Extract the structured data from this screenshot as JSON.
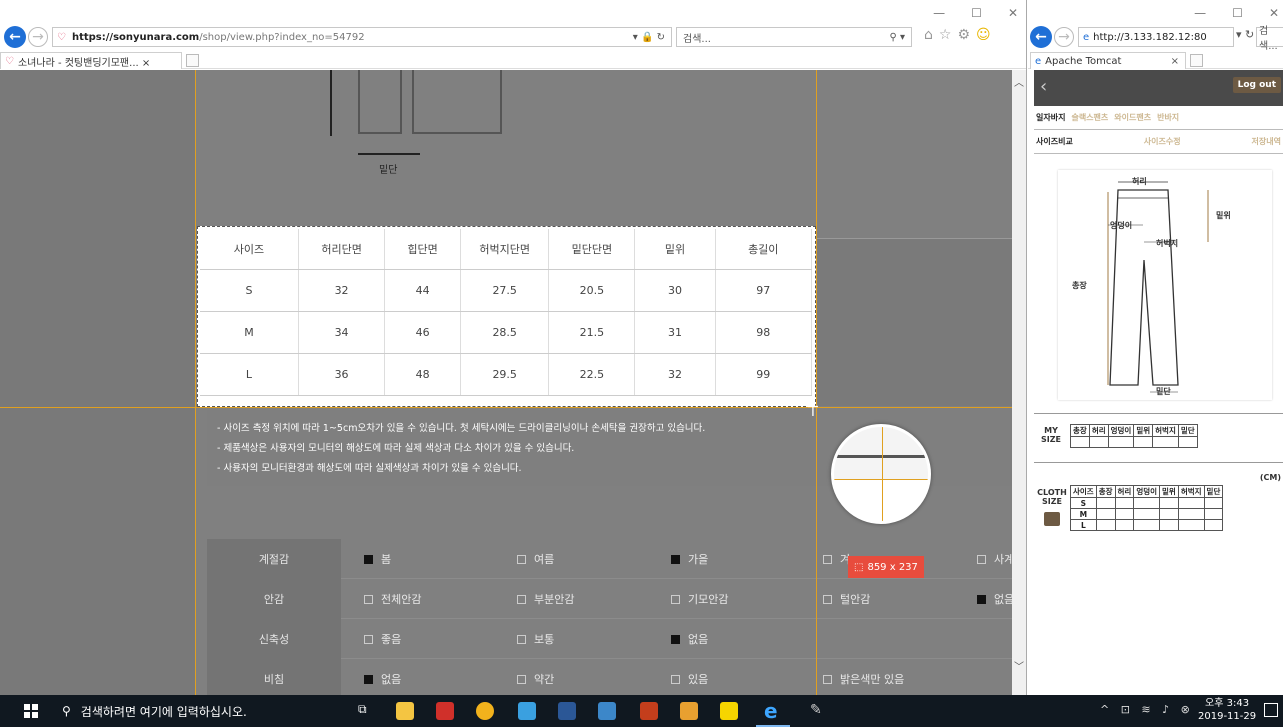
{
  "left_browser": {
    "url_prefix": "https://sonyunara.com",
    "url_path": "/shop/view.php?index_no=54792",
    "search_placeholder": "검색...",
    "tab_title": "소녀나라 - 컷팅밴딩기모팬... ×"
  },
  "page": {
    "diagram_label": "밑단",
    "measure_table": {
      "headers": [
        "사이즈",
        "허리단면",
        "힙단면",
        "허벅지단면",
        "밑단단면",
        "밑위",
        "총길이"
      ],
      "rows": [
        [
          "S",
          "32",
          "44",
          "27.5",
          "20.5",
          "30",
          "97"
        ],
        [
          "M",
          "34",
          "46",
          "28.5",
          "21.5",
          "31",
          "98"
        ],
        [
          "L",
          "36",
          "48",
          "29.5",
          "22.5",
          "32",
          "99"
        ]
      ]
    },
    "notes": [
      "- 사이즈 측정 위치에 따라 1~5cm오차가 있을 수 있습니다. 첫 세탁시에는 드라이클리닝이나 손세탁을 권장하고 있습니다.",
      "- 제품색상은 사용자의 모니터의 해상도에 따라 실제 색상과 다소 차이가 있을 수 있습니다.",
      "- 사용자의 모니터환경과 해상도에 따라 실제색상과 차이가 있을 수 있습니다."
    ],
    "attributes": [
      {
        "label": "계절감",
        "options": [
          {
            "text": "봄",
            "checked": true
          },
          {
            "text": "여름",
            "checked": false
          },
          {
            "text": "가을",
            "checked": true
          },
          {
            "text": "겨",
            "checked": false
          },
          {
            "text": "사계",
            "checked": false
          }
        ]
      },
      {
        "label": "안감",
        "options": [
          {
            "text": "전체안감",
            "checked": false
          },
          {
            "text": "부분안감",
            "checked": false
          },
          {
            "text": "기모안감",
            "checked": false
          },
          {
            "text": "털안감",
            "checked": false
          },
          {
            "text": "없음",
            "checked": true
          }
        ]
      },
      {
        "label": "신축성",
        "options": [
          {
            "text": "좋음",
            "checked": false
          },
          {
            "text": "보통",
            "checked": false
          },
          {
            "text": "없음",
            "checked": true
          }
        ]
      },
      {
        "label": "비침",
        "options": [
          {
            "text": "없음",
            "checked": true
          },
          {
            "text": "약간",
            "checked": false
          },
          {
            "text": "있음",
            "checked": false
          },
          {
            "text": "밝은색만 있음",
            "checked": false
          }
        ]
      }
    ],
    "capture_size": "859 x 237"
  },
  "right_browser": {
    "url": "http://3.133.182.12:80",
    "search_placeholder": "검색...",
    "tab_title": "Apache Tomcat",
    "logout_label": "Log out",
    "category_tabs": [
      "일자바지",
      "슬랙스팬츠",
      "와이드팬츠",
      "반바지"
    ],
    "sub_tabs": [
      "사이즈비교",
      "사이즈수정",
      "저장내역"
    ],
    "pants_labels": {
      "waist": "허리",
      "rise": "밑위",
      "hip": "엉덩이",
      "thigh": "허벅지",
      "length": "총장",
      "hem": "밑단"
    },
    "my_size_label": "MY SIZE",
    "my_size_headers": [
      "총장",
      "허리",
      "엉덩이",
      "밑위",
      "허벅지",
      "밑단"
    ],
    "unit_label": "(CM)",
    "cloth_size_label": "CLOTH SIZE",
    "cloth_headers": [
      "사이즈",
      "총장",
      "허리",
      "엉덩이",
      "밑위",
      "허벅지",
      "밑단"
    ],
    "cloth_sizes": [
      "S",
      "M",
      "L"
    ]
  },
  "taskbar": {
    "search_placeholder": "검색하려면 여기에 입력하십시오.",
    "time": "오후 3:43",
    "date": "2019-11-29"
  }
}
